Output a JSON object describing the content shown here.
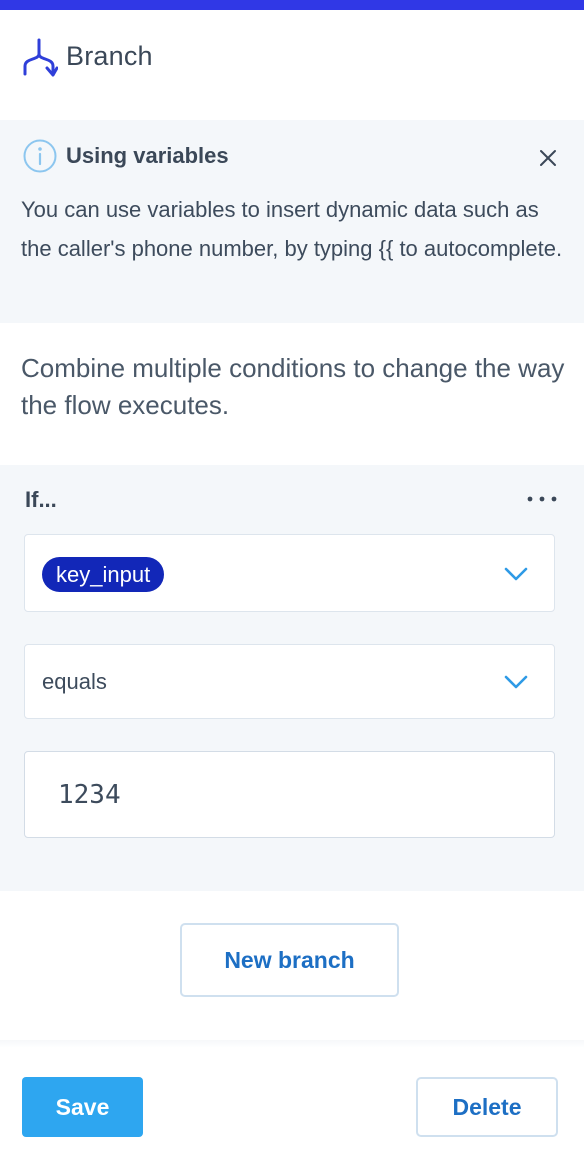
{
  "header": {
    "title": "Branch",
    "icon": "branch-icon",
    "accent_color": "#3038e6"
  },
  "info_banner": {
    "icon": "info-icon",
    "title": "Using variables",
    "text": "You can use variables to insert dynamic data such as the caller's phone number, by typing {{ to autocomplete.",
    "close_icon": "close-icon"
  },
  "description": "Combine multiple conditions to change the way the flow executes.",
  "condition": {
    "label": "If...",
    "more_icon": "more-horizontal-icon",
    "variable": "key_input",
    "operator": "equals",
    "value": "1234"
  },
  "actions": {
    "new_branch_label": "New branch",
    "save_label": "Save",
    "delete_label": "Delete",
    "primary_color": "#2ea6f0",
    "link_color": "#1d6fc4"
  }
}
